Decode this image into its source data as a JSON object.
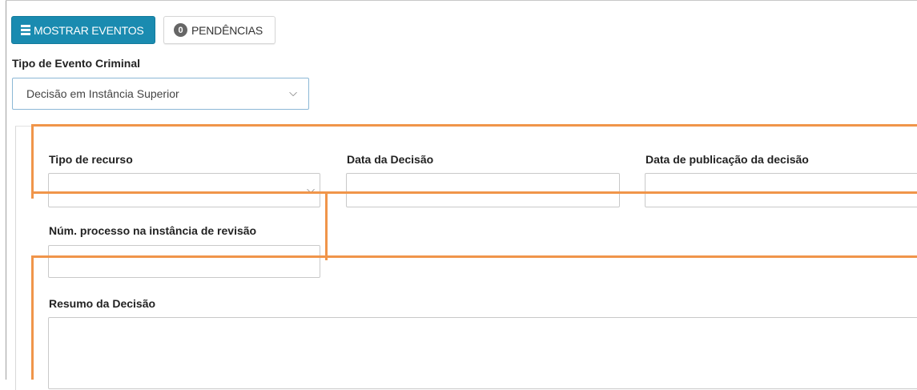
{
  "toolbar": {
    "show_events_label": "MOSTRAR EVENTOS",
    "pending_count": "0",
    "pending_label": "PENDÊNCIAS"
  },
  "event_type": {
    "label": "Tipo de Evento Criminal",
    "selected": "Decisão em Instância Superior"
  },
  "form": {
    "appeal_type_label": "Tipo de recurso",
    "appeal_type_value": "",
    "decision_date_label": "Data da Decisão",
    "decision_date_value": "",
    "publication_date_label": "Data de publicação da decisão",
    "publication_date_value": "",
    "process_number_label": "Núm. processo na instância de revisão",
    "process_number_value": "",
    "summary_label": "Resumo da Decisão",
    "summary_value": ""
  },
  "colors": {
    "primary": "#1a8bb0",
    "highlight": "#f0954a"
  },
  "icons": [
    "list-icon",
    "chevron-down-icon"
  ]
}
